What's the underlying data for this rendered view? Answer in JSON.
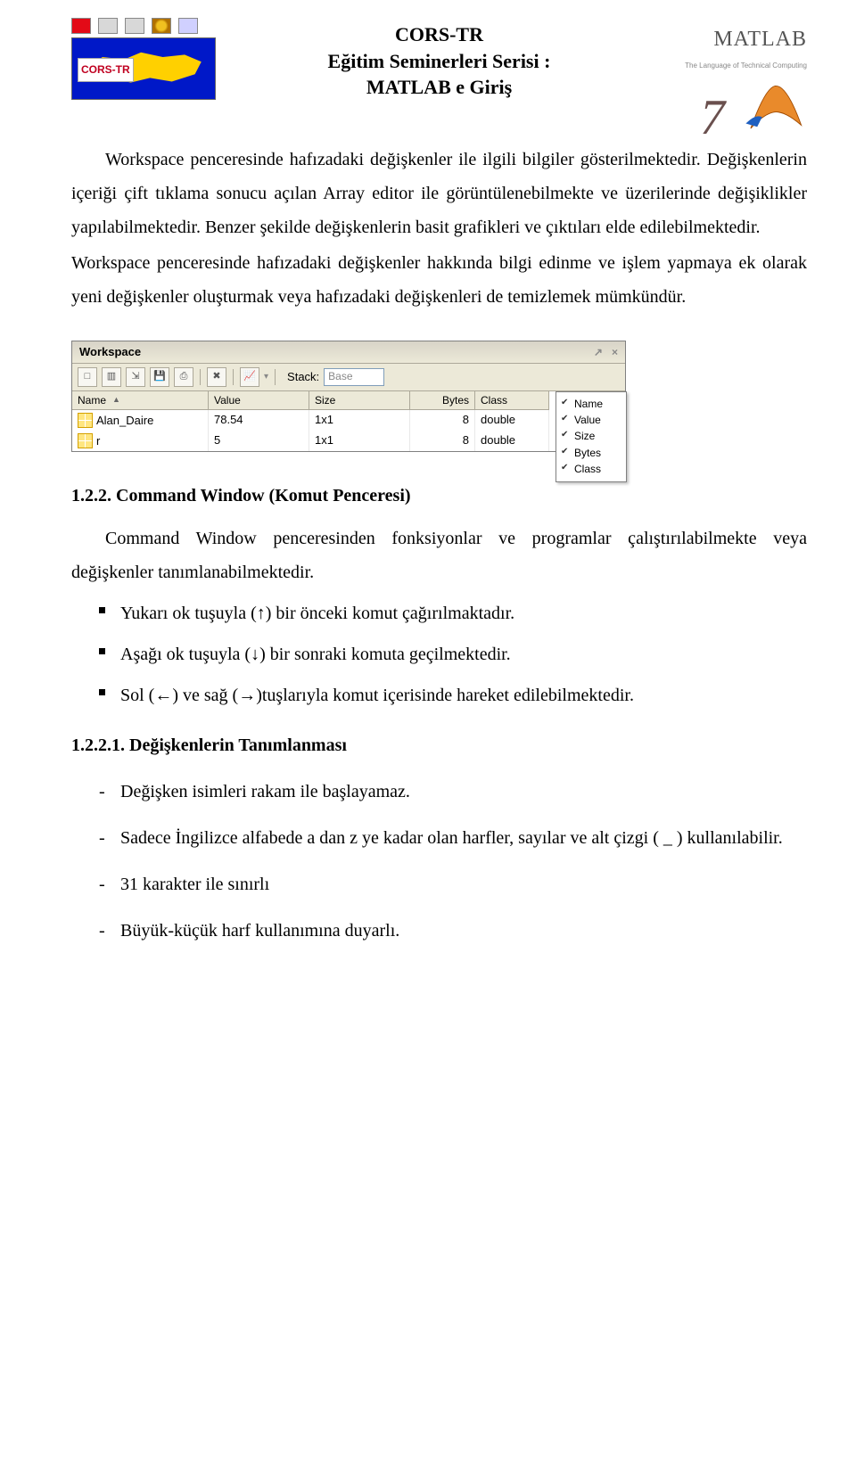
{
  "header": {
    "map_label": "CORS-TR",
    "title_line1": "CORS-TR",
    "title_line2": "Eğitim Seminerleri Serisi :",
    "title_line3": "MATLAB e Giriş",
    "matlab_word": "MATLAB",
    "matlab_tag": "The Language of Technical Computing",
    "matlab_version": "7"
  },
  "paragraphs": {
    "p1": "Workspace penceresinde hafızadaki değişkenler ile ilgili bilgiler gösterilmektedir. Değişkenlerin içeriği çift tıklama sonucu açılan Array editor ile görüntülenebilmekte ve üzerilerinde değişiklikler yapılabilmektedir. Benzer şekilde değişkenlerin basit grafikleri ve çıktıları elde edilebilmektedir.",
    "p2": "Workspace penceresinde hafızadaki değişkenler hakkında bilgi edinme ve  işlem yapmaya ek olarak yeni değişkenler oluşturmak veya hafızadaki değişkenleri de temizlemek mümkündür."
  },
  "workspace": {
    "title": "Workspace",
    "stack_label": "Stack:",
    "stack_value": "Base",
    "columns": {
      "name": "Name",
      "value": "Value",
      "size": "Size",
      "bytes": "Bytes",
      "class": "Class"
    },
    "rows": [
      {
        "name": "Alan_Daire",
        "value": "78.54",
        "size": "1x1",
        "bytes": "8",
        "class": "double"
      },
      {
        "name": "r",
        "value": "5",
        "size": "1x1",
        "bytes": "8",
        "class": "double"
      }
    ],
    "context_menu": [
      "Name",
      "Value",
      "Size",
      "Bytes",
      "Class"
    ]
  },
  "section122": {
    "heading": "1.2.2.   Command Window (Komut Penceresi)",
    "intro": "Command Window penceresinden fonksiyonlar ve programlar çalıştırılabilmekte veya  değişkenler tanımlanabilmektedir.",
    "bullets": [
      "Yukarı ok tuşuyla (↑) bir önceki komut çağırılmaktadır.",
      "Aşağı ok tuşuyla (↓) bir sonraki komuta geçilmektedir.",
      "Sol  (←) ve sağ  (→)tuşlarıyla komut içerisinde hareket edilebilmektedir."
    ]
  },
  "section1221": {
    "heading": "1.2.2.1. Değişkenlerin Tanımlanması",
    "items": [
      "Değişken isimleri rakam ile başlayamaz.",
      "Sadece İngilizce alfabede a dan z ye kadar olan harfler, sayılar ve alt çizgi ( _ ) kullanılabilir.",
      "31 karakter ile sınırlı",
      "Büyük-küçük harf kullanımına duyarlı."
    ]
  }
}
